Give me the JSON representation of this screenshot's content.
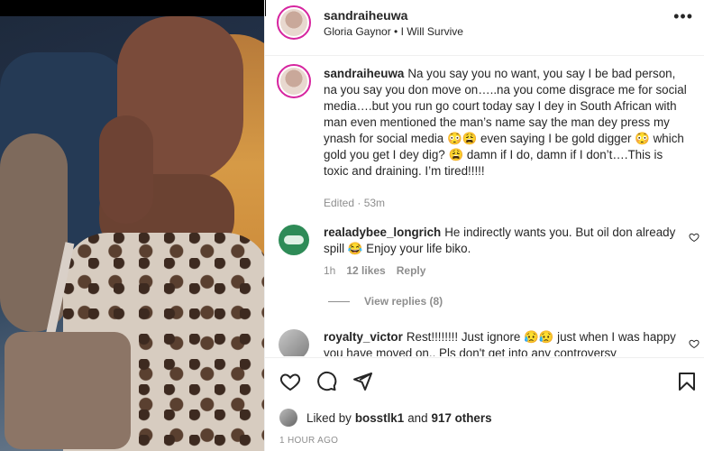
{
  "post": {
    "username": "sandraiheuwa",
    "audio": "Gloria Gaynor • I Will Survive",
    "more_icon": "more-horizontal-icon"
  },
  "caption": {
    "username": "sandraiheuwa",
    "text": "Na you say you no want, you say I be bad person, na you say you don move on…..na you come disgrace me for social media….but you run go court today say I dey in South African with man even mentioned the man’s name say the man dey press my ynash for social media 😳😩 even saying I be gold digger 😳 which gold you get I dey dig? 😩 damn if I do, damn if I don’t….This is toxic and draining. I’m tired!!!!!",
    "meta": "Edited · 53m"
  },
  "comments": [
    {
      "username": "realadybee_longrich",
      "text": "He indirectly wants you. But oil don already spill 😂 Enjoy your life biko.",
      "time": "1h",
      "likes": "12 likes",
      "reply": "Reply",
      "view_replies": "View replies (8)"
    },
    {
      "username": "royalty_victor",
      "text": "Rest!!!!!!!! Just ignore 😥😥 just when I was happy you have moved on.. Pls don't get into any controversy"
    }
  ],
  "actions": {
    "icons": [
      "heart-icon",
      "comment-icon",
      "share-icon",
      "bookmark-icon"
    ]
  },
  "likes": {
    "prefix": "Liked by",
    "user": "bosstlk1",
    "joiner": "and",
    "others": "917 others"
  },
  "timestamp": "1 hour ago"
}
